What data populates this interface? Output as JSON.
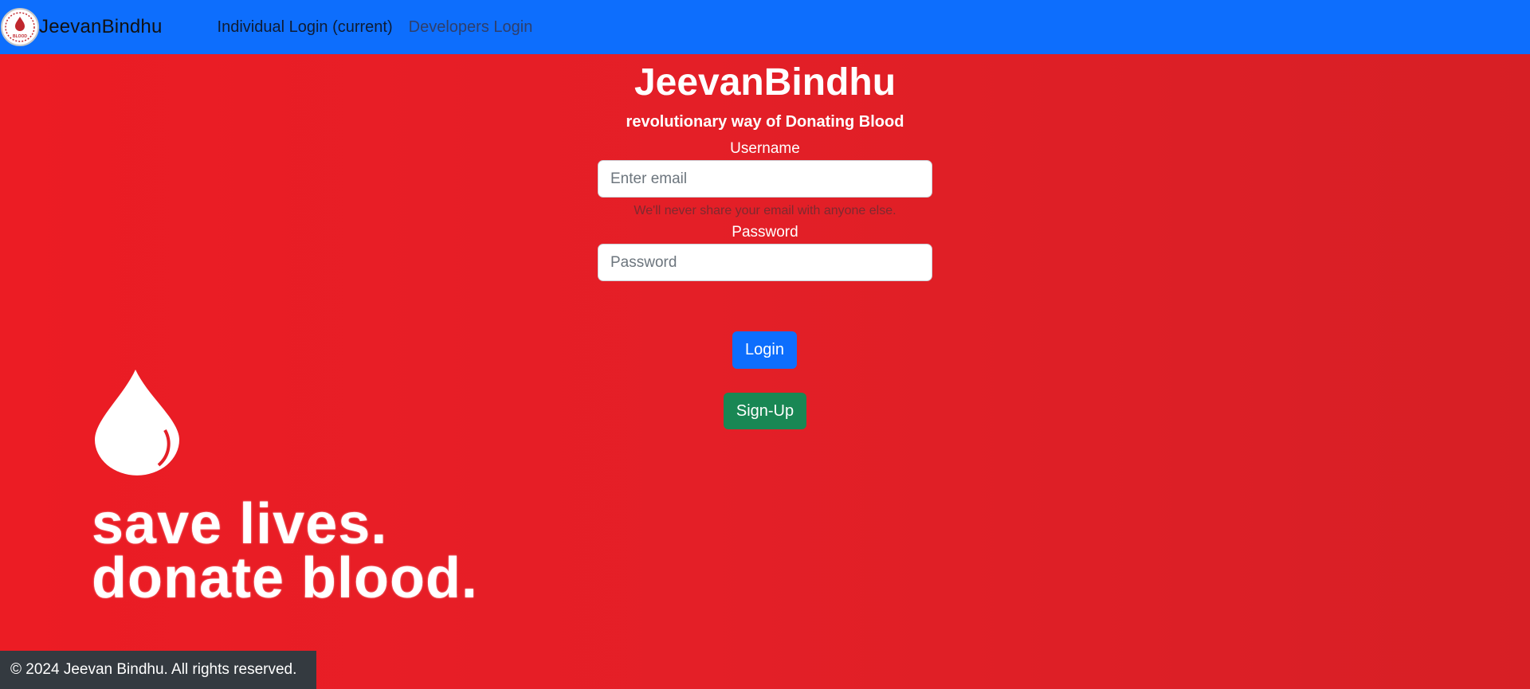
{
  "navbar": {
    "brand": "JeevanBindhu",
    "logo_text": "BLOOD",
    "links": [
      {
        "label": "Individual Login (current)"
      },
      {
        "label": "Developers Login"
      }
    ]
  },
  "hero": {
    "title": "JeevanBindhu",
    "subtitle": "revolutionary way of Donating Blood"
  },
  "form": {
    "username_label": "Username",
    "email_placeholder": "Enter email",
    "email_value": "",
    "email_help": "We'll never share your email with anyone else.",
    "password_label": "Password",
    "password_placeholder": "Password",
    "password_value": ""
  },
  "buttons": {
    "login": "Login",
    "signup": "Sign-Up"
  },
  "promo": {
    "line1": "save lives.",
    "line2": "donate blood."
  },
  "footer": {
    "text": "© 2024 Jeevan Bindhu. All rights reserved."
  },
  "colors": {
    "navbar": "#0d6efd",
    "background": "#e41f27",
    "login_button": "#0d6efd",
    "signup_button": "#198754",
    "footer": "#343a40"
  }
}
